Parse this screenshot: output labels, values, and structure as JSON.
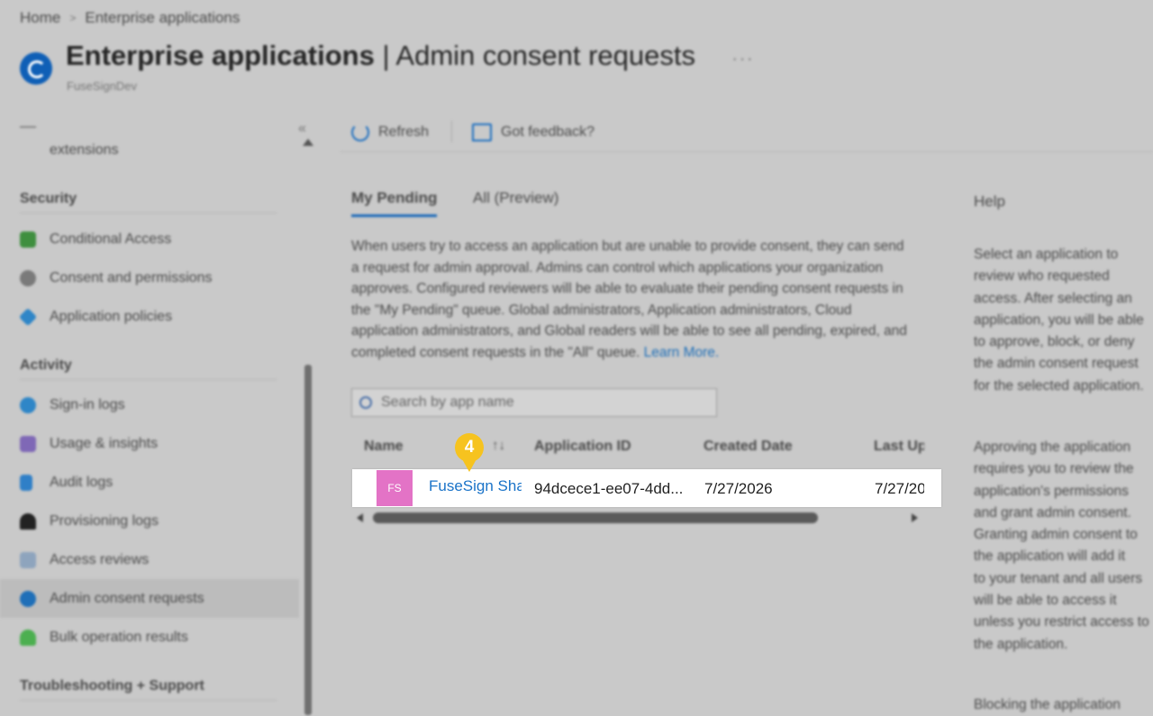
{
  "breadcrumb": {
    "home": "Home",
    "current": "Enterprise applications"
  },
  "header": {
    "title_bold": "Enterprise applications",
    "title_rest": " | Admin consent requests",
    "subtitle": "FuseSignDev",
    "more": "···"
  },
  "sidebar": {
    "collapse": "«",
    "ext_label": "extensions",
    "sections": {
      "security": "Security",
      "activity": "Activity",
      "troubleshooting": "Troubleshooting + Support"
    },
    "items": [
      {
        "label": "Conditional Access",
        "icon": "conditional-access-icon",
        "color": "#3f8f3f"
      },
      {
        "label": "Consent and permissions",
        "icon": "consent-icon",
        "color": "#7a7a7a"
      },
      {
        "label": "Application policies",
        "icon": "policies-icon",
        "color": "#2f86c7"
      },
      {
        "label": "Sign-in logs",
        "icon": "signin-logs-icon",
        "color": "#2f86c7"
      },
      {
        "label": "Usage & insights",
        "icon": "usage-icon",
        "color": "#7f68b6"
      },
      {
        "label": "Audit logs",
        "icon": "audit-logs-icon",
        "color": "#2f7fc7"
      },
      {
        "label": "Provisioning logs",
        "icon": "provisioning-icon",
        "color": "#222222"
      },
      {
        "label": "Access reviews",
        "icon": "access-reviews-icon",
        "color": "#8ea4bd"
      },
      {
        "label": "Admin consent requests",
        "icon": "admin-consent-icon",
        "color": "#1f6fb8"
      },
      {
        "label": "Bulk operation results",
        "icon": "bulk-ops-icon",
        "color": "#4caf50"
      }
    ]
  },
  "toolbar": {
    "refresh": "Refresh",
    "feedback": "Got feedback?"
  },
  "tabs": {
    "pending": "My Pending",
    "all": "All (Preview)"
  },
  "description": {
    "text": "When users try to access an application but are unable to provide consent, they can send a request for admin approval. Admins can control which applications your organization approves. Configured reviewers will be able to evaluate their pending consent requests in the \"My Pending\" queue. Global administrators, Application administrators, Cloud application administrators, and Global readers will be able to see all pending, expired, and completed consent requests in the \"All\" queue.",
    "link": "Learn More."
  },
  "search": {
    "placeholder": "Search by app name"
  },
  "table": {
    "headers": {
      "name": "Name",
      "app_id": "Application ID",
      "created": "Created Date",
      "last": "Last Up"
    },
    "sort": "↑↓",
    "row": {
      "avatar": "FS",
      "name": "FuseSign Sha",
      "app_id": "94dcece1-ee07-4dd...",
      "created": "7/27/2026",
      "last": "7/27/20"
    }
  },
  "help": {
    "title": "Help",
    "para1": [
      "Select an application to",
      "review who requested",
      "access. After selecting an",
      "application, you will be able",
      "to approve, block, or deny",
      "the admin consent request",
      "for the selected application."
    ],
    "para2": [
      "Approving the application",
      "requires you to review the",
      "application's permissions",
      "and grant admin consent.",
      "Granting admin consent to",
      "the application will add it",
      "to your tenant and all users",
      "will be able to access it",
      "unless you restrict access to",
      "the application."
    ],
    "para3": [
      "Blocking the application"
    ]
  },
  "step_badge": "4",
  "colors": {
    "accent": "#1b69b8",
    "avatar": "#e373c6",
    "badge": "#f6c31f",
    "overlay": "#c9c9c9"
  }
}
